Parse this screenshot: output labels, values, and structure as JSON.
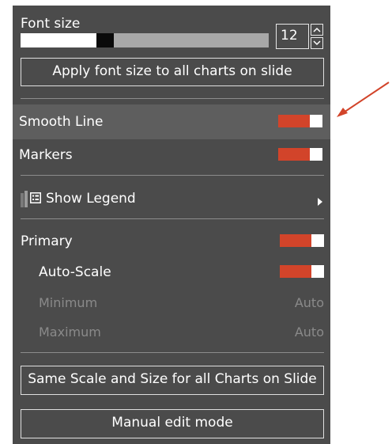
{
  "font_size": {
    "label": "Font size",
    "value": "12",
    "slider_level": 0.35,
    "apply_button": "Apply font size to all charts on slide"
  },
  "toggles": {
    "smooth_line": {
      "label": "Smooth Line",
      "on": true
    },
    "markers": {
      "label": "Markers",
      "on": true
    },
    "primary": {
      "label": "Primary",
      "on": true
    },
    "auto_scale": {
      "label": "Auto-Scale",
      "on": true
    }
  },
  "legend": {
    "label": "Show Legend"
  },
  "scale": {
    "minimum_label": "Minimum",
    "minimum_value": "Auto",
    "maximum_label": "Maximum",
    "maximum_value": "Auto"
  },
  "buttons": {
    "same_scale": "Same Scale and Size for all Charts on Slide",
    "manual_edit": "Manual edit mode"
  },
  "colors": {
    "panel": "#4b4b4b",
    "toggle_on": "#d2442a",
    "arrow": "#d2442a"
  }
}
